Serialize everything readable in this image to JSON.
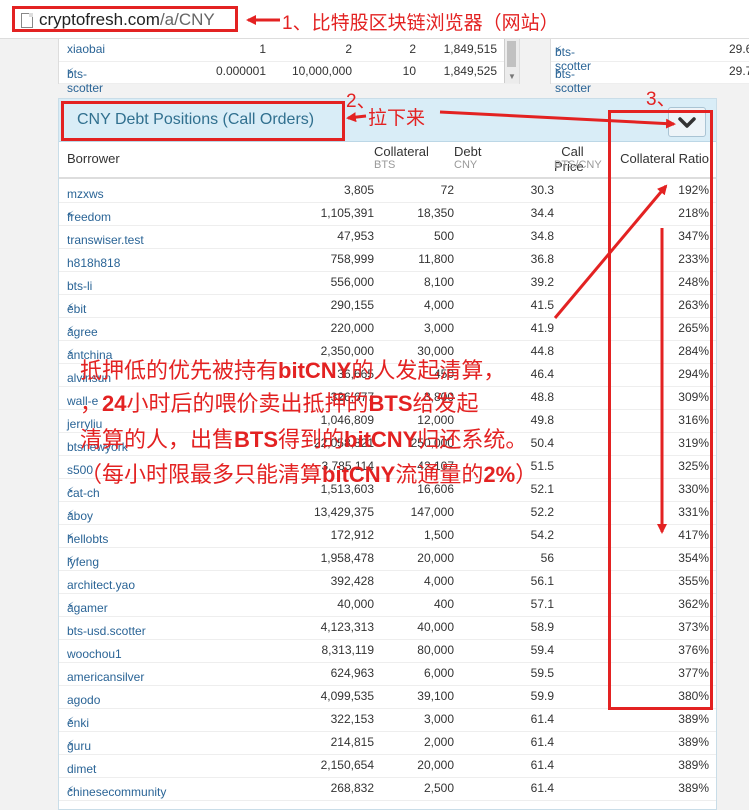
{
  "address_bar": {
    "url_host": "cryptofresh.com",
    "url_path": "/a/CNY"
  },
  "annotations": {
    "a1": "1、比特股区块链浏览器（网站）",
    "a2": "2、",
    "a2_label": "拉下来",
    "a3": "3、",
    "note_l1_a": "抵押低的优先被持有",
    "note_l1_b": "bitCNY",
    "note_l1_c": "的人发起清算，",
    "note_l2_a": "，",
    "note_l2_b": "24",
    "note_l2_c": "小时后的喂价卖出抵押的",
    "note_l2_d": "BTS",
    "note_l2_e": "给发起",
    "note_l3_a": "清算的人，出售",
    "note_l3_b": "BTS",
    "note_l3_c": "得到的",
    "note_l3_d": "bitCNY",
    "note_l3_e": "归还系统。",
    "note_l4_a": "（每小时限最多只能清算",
    "note_l4_b": "bitCNY",
    "note_l4_c": "流通量的",
    "note_l4_d": "2%",
    "note_l4_e": "）"
  },
  "top_left_table": [
    {
      "name": "xiaobai",
      "c1": "1",
      "c2": "2",
      "c3": "2",
      "c4": "1,849,515"
    },
    {
      "name": "bts-scotter",
      "c1": "0.000001",
      "c2": "10,000,000",
      "c3": "10",
      "c4": "1,849,525"
    }
  ],
  "top_right_table": [
    {
      "name": "bts-scotter",
      "val": "29.6"
    },
    {
      "name": "bts-scotter",
      "val": "29.7"
    }
  ],
  "panel": {
    "title": "CNY Debt Positions (Call Orders)",
    "columns": {
      "borrower": "Borrower",
      "collateral": "Collateral",
      "collateral_unit": "BTS",
      "debt": "Debt",
      "debt_unit": "CNY",
      "call_price": "Call Price",
      "call_price_unit": "BTS/CNY",
      "ratio": "Collateral Ratio"
    },
    "rows": [
      {
        "borrower": "mzxws",
        "bolt": false,
        "collateral": "3,805",
        "debt": "72",
        "price": "30.3",
        "ratio": "192%"
      },
      {
        "borrower": "freedom",
        "bolt": true,
        "collateral": "1,105,391",
        "debt": "18,350",
        "price": "34.4",
        "ratio": "218%"
      },
      {
        "borrower": "transwiser.test",
        "bolt": false,
        "collateral": "47,953",
        "debt": "500",
        "price": "34.8",
        "ratio": "347%"
      },
      {
        "borrower": "h818h818",
        "bolt": false,
        "collateral": "758,999",
        "debt": "11,800",
        "price": "36.8",
        "ratio": "233%"
      },
      {
        "borrower": "bts-li",
        "bolt": false,
        "collateral": "556,000",
        "debt": "8,100",
        "price": "39.2",
        "ratio": "248%"
      },
      {
        "borrower": "ebit",
        "bolt": true,
        "collateral": "290,155",
        "debt": "4,000",
        "price": "41.5",
        "ratio": "263%"
      },
      {
        "borrower": "agree",
        "bolt": true,
        "collateral": "220,000",
        "debt": "3,000",
        "price": "41.9",
        "ratio": "265%"
      },
      {
        "borrower": "antchina",
        "bolt": true,
        "collateral": "2,350,000",
        "debt": "30,000",
        "price": "44.8",
        "ratio": "284%"
      },
      {
        "borrower": "alvinsun",
        "bolt": false,
        "collateral": "36,665",
        "debt": "450",
        "price": "46.4",
        "ratio": "294%"
      },
      {
        "borrower": "wall-e",
        "bolt": false,
        "collateral": "326,677",
        "debt": "3,800",
        "price": "48.8",
        "ratio": "309%"
      },
      {
        "borrower": "jerryliu",
        "bolt": false,
        "collateral": "1,046,809",
        "debt": "12,000",
        "price": "49.8",
        "ratio": "316%"
      },
      {
        "borrower": "btsnewyork",
        "bolt": false,
        "collateral": "22,058,821",
        "debt": "250,000",
        "price": "50.4",
        "ratio": "319%"
      },
      {
        "borrower": "s500",
        "bolt": false,
        "collateral": "3,785,114",
        "debt": "42,107",
        "price": "51.5",
        "ratio": "325%"
      },
      {
        "borrower": "cat-ch",
        "bolt": true,
        "collateral": "1,513,603",
        "debt": "16,606",
        "price": "52.1",
        "ratio": "330%"
      },
      {
        "borrower": "aboy",
        "bolt": true,
        "collateral": "13,429,375",
        "debt": "147,000",
        "price": "52.2",
        "ratio": "331%"
      },
      {
        "borrower": "hellobts",
        "bolt": true,
        "collateral": "172,912",
        "debt": "1,500",
        "price": "54.2",
        "ratio": "417%"
      },
      {
        "borrower": "lyfeng",
        "bolt": true,
        "collateral": "1,958,478",
        "debt": "20,000",
        "price": "56",
        "ratio": "354%"
      },
      {
        "borrower": "architect.yao",
        "bolt": false,
        "collateral": "392,428",
        "debt": "4,000",
        "price": "56.1",
        "ratio": "355%"
      },
      {
        "borrower": "agamer",
        "bolt": true,
        "collateral": "40,000",
        "debt": "400",
        "price": "57.1",
        "ratio": "362%"
      },
      {
        "borrower": "bts-usd.scotter",
        "bolt": false,
        "collateral": "4,123,313",
        "debt": "40,000",
        "price": "58.9",
        "ratio": "373%"
      },
      {
        "borrower": "woochou1",
        "bolt": false,
        "collateral": "8,313,119",
        "debt": "80,000",
        "price": "59.4",
        "ratio": "376%"
      },
      {
        "borrower": "americansilver",
        "bolt": false,
        "collateral": "624,963",
        "debt": "6,000",
        "price": "59.5",
        "ratio": "377%"
      },
      {
        "borrower": "agodo",
        "bolt": false,
        "collateral": "4,099,535",
        "debt": "39,100",
        "price": "59.9",
        "ratio": "380%"
      },
      {
        "borrower": "enki",
        "bolt": true,
        "collateral": "322,153",
        "debt": "3,000",
        "price": "61.4",
        "ratio": "389%"
      },
      {
        "borrower": "guru",
        "bolt": true,
        "collateral": "214,815",
        "debt": "2,000",
        "price": "61.4",
        "ratio": "389%"
      },
      {
        "borrower": "dimet",
        "bolt": false,
        "collateral": "2,150,654",
        "debt": "20,000",
        "price": "61.4",
        "ratio": "389%"
      },
      {
        "borrower": "chinesecommunity",
        "bolt": true,
        "collateral": "268,832",
        "debt": "2,500",
        "price": "61.4",
        "ratio": "389%"
      }
    ]
  },
  "colors": {
    "annotation_red": "#e32222",
    "link_blue": "#2a6496",
    "panel_head": "#d9edf7"
  }
}
